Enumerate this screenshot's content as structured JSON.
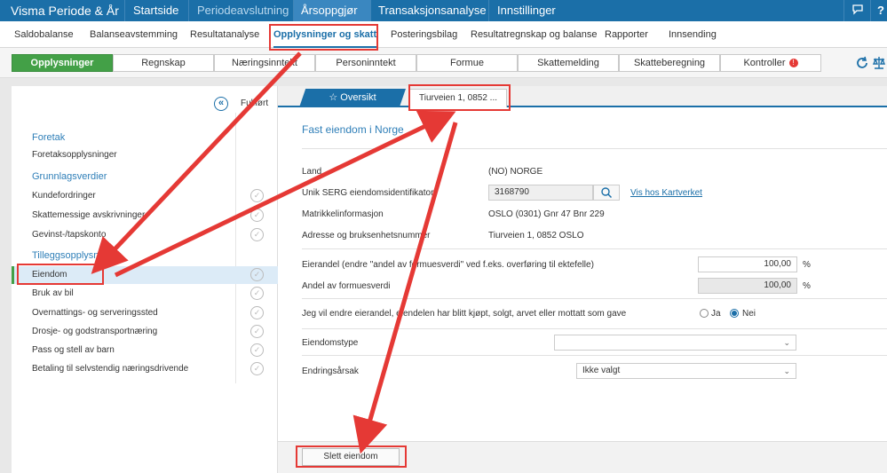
{
  "topbar": {
    "brand": "Visma Periode & År",
    "tabs": [
      "Startside",
      "Periodeavslutning",
      "Årsoppgjør",
      "Transaksjonsanalyse",
      "Innstillinger"
    ]
  },
  "subtabs": [
    "Saldobalanse",
    "Balanseavstemming",
    "Resultatanalyse",
    "Opplysninger og skatt",
    "Posteringsbilag",
    "Resultatregnskap og balanse",
    "Rapporter",
    "Innsending"
  ],
  "pills": [
    "Opplysninger",
    "Regnskap",
    "Næringsinntekt",
    "Personinntekt",
    "Formue",
    "Skattemelding",
    "Skatteberegning",
    "Kontroller"
  ],
  "left": {
    "fullfort": "Fullført",
    "foretak_head": "Foretak",
    "foretak_item": "Foretaksopplysninger",
    "grunn_head": "Grunnlagsverdier",
    "grunn_items": [
      "Kundefordringer",
      "Skattemessige avskrivninger",
      "Gevinst-/tapskonto"
    ],
    "tillegg_head": "Tilleggsopplysninger",
    "tillegg_items": [
      "Eiendom",
      "Bruk av bil",
      "Overnattings- og serveringssted",
      "Drosje- og godstransportnæring",
      "Pass og stell av barn",
      "Betaling til selvstendig næringsdrivende"
    ]
  },
  "right": {
    "tab_oversikt": "Oversikt",
    "tab_property": "Tiurveien 1, 0852 ...",
    "section_title": "Fast eiendom i Norge",
    "land_label": "Land",
    "land_value": "(NO) NORGE",
    "serg_label": "Unik SERG eiendomsidentifikator",
    "serg_value": "3168790",
    "kartverket_link": "Vis hos Kartverket",
    "matrikkel_label": "Matrikkelinformasjon",
    "matrikkel_value": "OSLO (0301) Gnr 47 Bnr 229",
    "adresse_label": "Adresse og bruksenhetsnummer",
    "adresse_value": "Tiurveien 1, 0852 OSLO",
    "eierandel_label": "Eierandel (endre \"andel av formuesverdi\" ved f.eks. overføring til ektefelle)",
    "eierandel_value": "100,00",
    "andel_label": "Andel av formuesverdi",
    "andel_value": "100,00",
    "percent": "%",
    "endre_label": "Jeg vil endre eierandel, eiendelen har blitt kjøpt, solgt, arvet eller mottatt som gave",
    "radio_ja": "Ja",
    "radio_nei": "Nei",
    "eiendomstype_label": "Eiendomstype",
    "eiendomstype_value": "",
    "endringsarsak_label": "Endringsårsak",
    "endringsarsak_value": "Ikke valgt",
    "delete_button": "Slett eiendom"
  },
  "colors": {
    "primary": "#1b6fa8",
    "active_green": "#43a047",
    "annotation_red": "#e53935"
  }
}
